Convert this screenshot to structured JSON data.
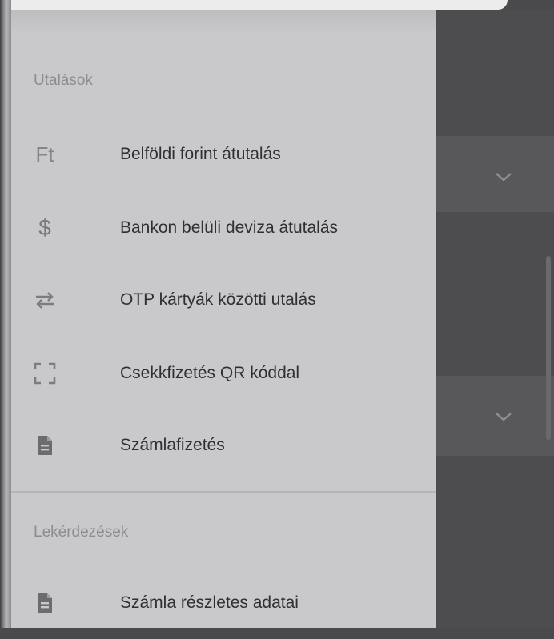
{
  "sections": [
    {
      "header": "Utalások",
      "items": [
        {
          "icon": "forint-icon",
          "icon_text": "Ft",
          "label": "Belföldi forint átutalás"
        },
        {
          "icon": "dollar-icon",
          "icon_text": "$",
          "label": "Bankon belüli deviza átutalás"
        },
        {
          "icon": "swap-arrows-icon",
          "label": "OTP kártyák közötti utalás"
        },
        {
          "icon": "qr-scan-frame-icon",
          "label": "Csekkfizetés QR kóddal"
        },
        {
          "icon": "document-icon",
          "label": "Számlafizetés"
        }
      ]
    },
    {
      "header": "Lekérdezések",
      "items": [
        {
          "icon": "document-icon",
          "label": "Számla részletes adatai"
        }
      ]
    }
  ],
  "colors": {
    "drawer_bg": "#c9c9cb",
    "section_header": "#8d8d90",
    "item_text": "#303033",
    "backdrop": "#4a4a4c"
  }
}
